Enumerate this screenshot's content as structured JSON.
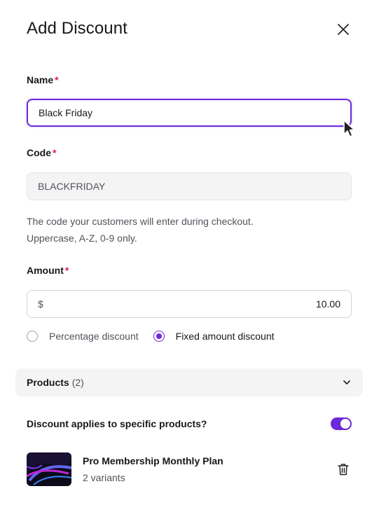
{
  "dialog": {
    "title": "Add Discount"
  },
  "name_field": {
    "label": "Name",
    "required_mark": "*",
    "value": "Black Friday"
  },
  "code_field": {
    "label": "Code",
    "required_mark": "*",
    "value": "BLACKFRIDAY",
    "help_line1": "The code your customers will enter during checkout.",
    "help_line2": "Uppercase, A-Z, 0-9 only."
  },
  "amount_field": {
    "label": "Amount",
    "required_mark": "*",
    "currency": "$",
    "value": "10.00"
  },
  "discount_type": {
    "options": [
      {
        "label": "Percentage discount",
        "checked": false
      },
      {
        "label": "Fixed amount discount",
        "checked": true
      }
    ]
  },
  "products_section": {
    "title": "Products",
    "count": "(2)"
  },
  "specific_products": {
    "label": "Discount applies to specific products?",
    "enabled": true
  },
  "products": [
    {
      "name": "Pro Membership Monthly Plan",
      "variants": "2 variants"
    }
  ],
  "colors": {
    "accent": "#6d28d9",
    "required": "#e11d48"
  },
  "icons": {
    "close": "close-icon",
    "chevron": "chevron-down-icon",
    "delete": "trash-icon"
  }
}
